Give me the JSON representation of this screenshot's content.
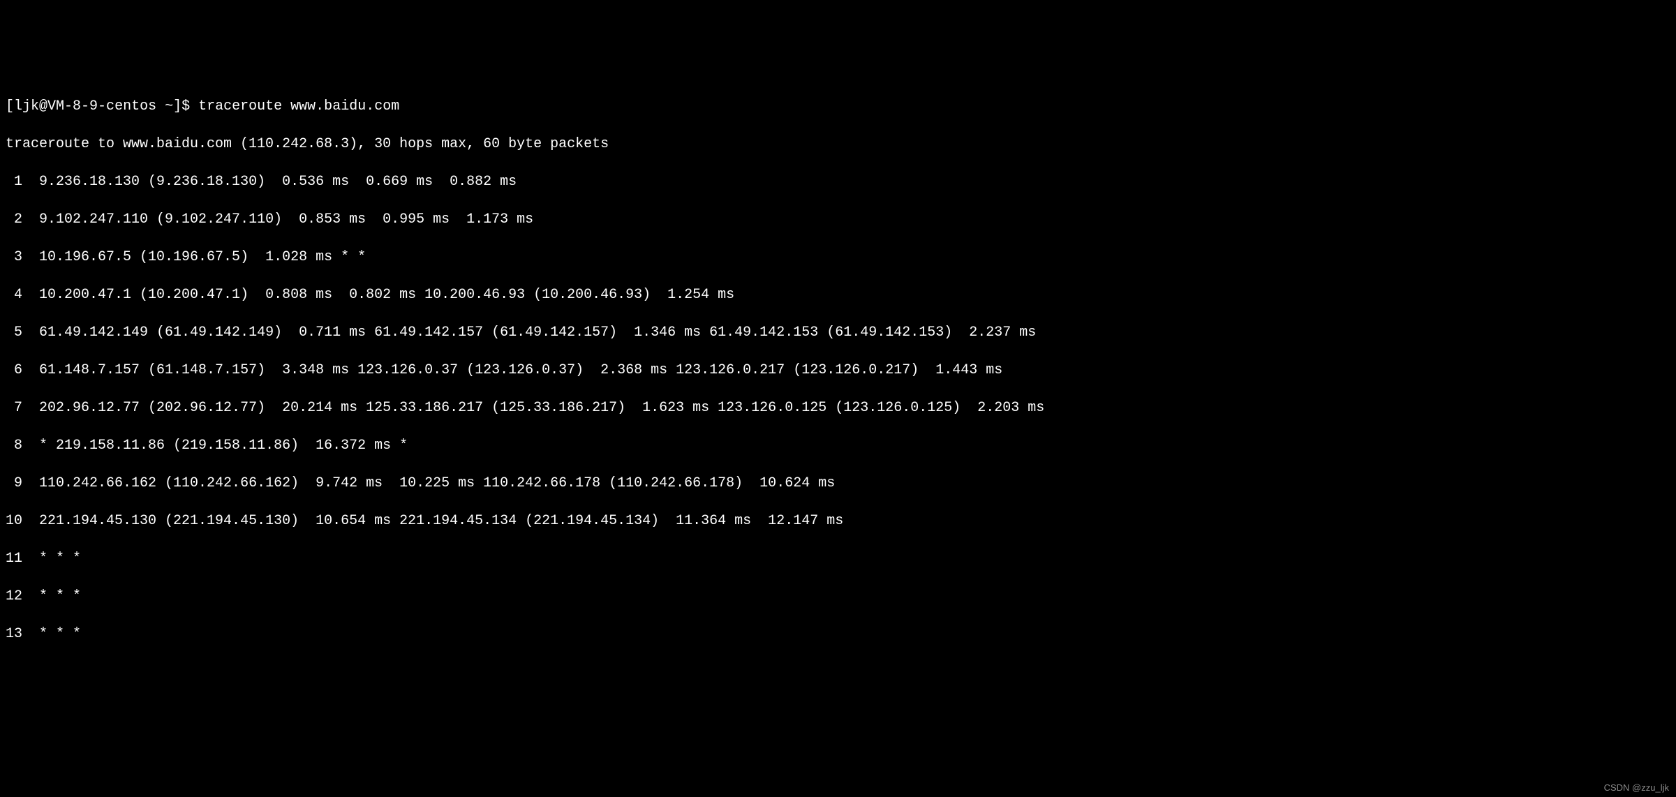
{
  "prompt": {
    "user": "ljk",
    "host": "VM-8-9-centos",
    "dir": "~",
    "symbol": "$",
    "command": "traceroute www.baidu.com"
  },
  "header": "traceroute to www.baidu.com (110.242.68.3), 30 hops max, 60 byte packets",
  "hops": [
    {
      "num": "1",
      "text": "9.236.18.130 (9.236.18.130)  0.536 ms  0.669 ms  0.882 ms"
    },
    {
      "num": "2",
      "text": "9.102.247.110 (9.102.247.110)  0.853 ms  0.995 ms  1.173 ms"
    },
    {
      "num": "3",
      "text": "10.196.67.5 (10.196.67.5)  1.028 ms * *"
    },
    {
      "num": "4",
      "text": "10.200.47.1 (10.200.47.1)  0.808 ms  0.802 ms 10.200.46.93 (10.200.46.93)  1.254 ms"
    },
    {
      "num": "5",
      "text": "61.49.142.149 (61.49.142.149)  0.711 ms 61.49.142.157 (61.49.142.157)  1.346 ms 61.49.142.153 (61.49.142.153)  2.237 ms"
    },
    {
      "num": "6",
      "text": "61.148.7.157 (61.148.7.157)  3.348 ms 123.126.0.37 (123.126.0.37)  2.368 ms 123.126.0.217 (123.126.0.217)  1.443 ms"
    },
    {
      "num": "7",
      "text": "202.96.12.77 (202.96.12.77)  20.214 ms 125.33.186.217 (125.33.186.217)  1.623 ms 123.126.0.125 (123.126.0.125)  2.203 ms"
    },
    {
      "num": "8",
      "text": "* 219.158.11.86 (219.158.11.86)  16.372 ms *"
    },
    {
      "num": "9",
      "text": "110.242.66.162 (110.242.66.162)  9.742 ms  10.225 ms 110.242.66.178 (110.242.66.178)  10.624 ms"
    },
    {
      "num": "10",
      "text": "221.194.45.130 (221.194.45.130)  10.654 ms 221.194.45.134 (221.194.45.134)  11.364 ms  12.147 ms"
    },
    {
      "num": "11",
      "text": "* * *"
    },
    {
      "num": "12",
      "text": "* * *"
    },
    {
      "num": "13",
      "text": "* * *"
    }
  ],
  "watermark": "CSDN @zzu_ljk"
}
